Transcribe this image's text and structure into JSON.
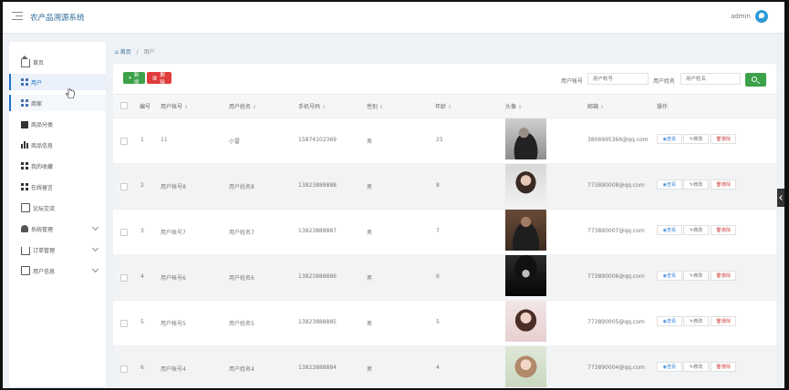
{
  "app": {
    "title": "农产品溯源系统",
    "user": "admin"
  },
  "sidebar": {
    "items": [
      {
        "label": "首页",
        "icon": "home-icon",
        "active": false
      },
      {
        "label": "用户",
        "icon": "grid-icon",
        "active": true
      },
      {
        "label": "商家",
        "icon": "grid-icon",
        "active": false
      },
      {
        "label": "商品分类",
        "icon": "film-icon",
        "active": false
      },
      {
        "label": "商品信息",
        "icon": "bar-chart-icon",
        "active": false
      },
      {
        "label": "我的收藏",
        "icon": "grid-icon",
        "active": false
      },
      {
        "label": "在线留言",
        "icon": "grid-icon",
        "active": false
      },
      {
        "label": "论坛交流",
        "icon": "chat-icon",
        "active": false
      },
      {
        "label": "系统管理",
        "icon": "user-icon",
        "active": false,
        "expandable": true
      },
      {
        "label": "订单管理",
        "icon": "cart-icon",
        "active": false,
        "expandable": true
      },
      {
        "label": "用户信息",
        "icon": "card-icon",
        "active": false,
        "expandable": true
      }
    ]
  },
  "breadcrumb": {
    "home": "首页",
    "current": "用户"
  },
  "toolbar": {
    "add_label": "新增",
    "delete_label": "删除",
    "account_label": "用户帐号",
    "account_placeholder": "用户帐号",
    "name_label": "用户姓名",
    "name_placeholder": "用户姓名"
  },
  "table": {
    "headers": {
      "index": "编号",
      "account": "用户帐号",
      "name": "用户姓名",
      "phone": "手机号码",
      "gender": "性别",
      "age": "年龄",
      "avatar": "头像",
      "email": "邮箱",
      "actions": "操作"
    },
    "action_labels": {
      "view": "查看",
      "edit": "修改",
      "delete": "删除"
    },
    "rows": [
      {
        "index": "1",
        "account": "11",
        "name": "小雷",
        "phone": "15874102369",
        "gender": "男",
        "age": "25",
        "email": "3806995366@qq.com"
      },
      {
        "index": "2",
        "account": "用户帐号8",
        "name": "用户姓名8",
        "phone": "13823888888",
        "gender": "男",
        "age": "8",
        "email": "773890008@qq.com"
      },
      {
        "index": "3",
        "account": "用户帐号7",
        "name": "用户姓名7",
        "phone": "13823888887",
        "gender": "男",
        "age": "7",
        "email": "773890007@qq.com"
      },
      {
        "index": "4",
        "account": "用户帐号6",
        "name": "用户姓名6",
        "phone": "13823888886",
        "gender": "男",
        "age": "6",
        "email": "773890006@qq.com"
      },
      {
        "index": "5",
        "account": "用户帐号5",
        "name": "用户姓名5",
        "phone": "13823888885",
        "gender": "男",
        "age": "5",
        "email": "773890005@qq.com"
      },
      {
        "index": "6",
        "account": "用户帐号4",
        "name": "用户姓名4",
        "phone": "13823888884",
        "gender": "男",
        "age": "4",
        "email": "773890004@qq.com"
      }
    ]
  },
  "colors": {
    "primary": "#1e71c1",
    "success": "#3da14a",
    "danger": "#e03b3b",
    "title": "#2d6b9a"
  }
}
